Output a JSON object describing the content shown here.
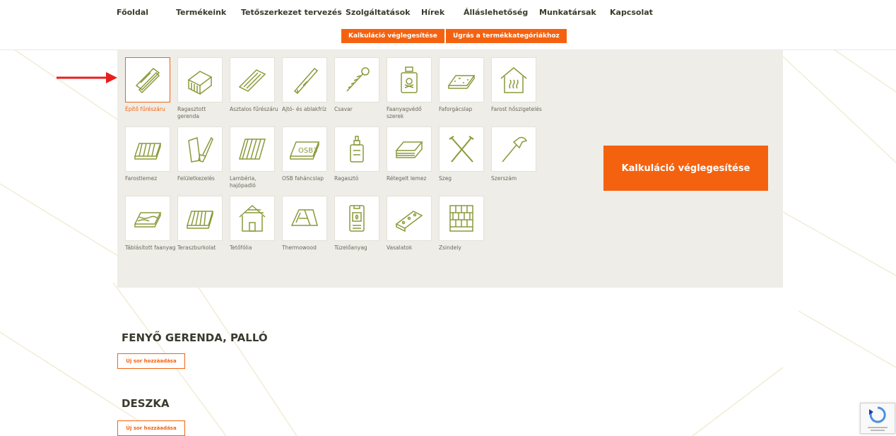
{
  "nav": {
    "items": [
      "Főoldal",
      "Termékeink",
      "Tetőszerkezet tervezés",
      "Szolgáltatások",
      "Hírek",
      "Álláslehetőség",
      "Munkatársak",
      "Kapcsolat"
    ],
    "btn_finalize": "Kalkuláció véglegesítése",
    "btn_jump": "Ugrás a termékkategóriákhoz"
  },
  "tiles": [
    {
      "label": "Építő fűrészáru",
      "icon": "lumber-icon",
      "active": true
    },
    {
      "label": "Ragasztott gerenda",
      "icon": "glued-beam-icon"
    },
    {
      "label": "Asztalos fűrészáru",
      "icon": "joinery-lumber-icon"
    },
    {
      "label": "Ajtó- és ablakfríz",
      "icon": "frieze-icon"
    },
    {
      "label": "Csavar",
      "icon": "screw-icon"
    },
    {
      "label": "Faanyagvédő szerek",
      "icon": "poison-bottle-icon"
    },
    {
      "label": "Faforgácslap",
      "icon": "chipboard-icon"
    },
    {
      "label": "Farost hőszigetelés",
      "icon": "insulation-house-icon"
    },
    {
      "label": "Farostlemez",
      "icon": "fiberboard-icon"
    },
    {
      "label": "Felületkezelés",
      "icon": "paint-brush-icon"
    },
    {
      "label": "Lambéria, hajópadló",
      "icon": "panelling-icon"
    },
    {
      "label": "OSB faháncslap",
      "icon": "osb-board-icon"
    },
    {
      "label": "Ragasztó",
      "icon": "glue-bottle-icon"
    },
    {
      "label": "Rétegelt lemez",
      "icon": "plywood-icon"
    },
    {
      "label": "Szeg",
      "icon": "nails-icon"
    },
    {
      "label": "Szerszám",
      "icon": "hammer-icon"
    },
    {
      "label": "Táblásított faanyag",
      "icon": "panel-wood-icon"
    },
    {
      "label": "Teraszburkolat",
      "icon": "decking-icon"
    },
    {
      "label": "Tetőfólia",
      "icon": "roof-foil-icon"
    },
    {
      "label": "Thermowood",
      "icon": "thermowood-icon"
    },
    {
      "label": "Tüzelőanyag",
      "icon": "stove-icon"
    },
    {
      "label": "Vasalatok",
      "icon": "bracket-icon"
    },
    {
      "label": "Zsindely",
      "icon": "shingle-icon"
    }
  ],
  "osb_text": "OSB3",
  "big_button": "Kalkuláció véglegesítése",
  "sections": [
    {
      "title": "FENYŐ GERENDA, PALLÓ",
      "add": "Új sor hozzáadása"
    },
    {
      "title": "DESZKA",
      "add": "Új sor hozzáadása"
    }
  ],
  "colors": {
    "accent": "#f5620f",
    "icon_green": "#8a9a3a",
    "panel": "#efede7",
    "arrow": "#e81e1e"
  }
}
